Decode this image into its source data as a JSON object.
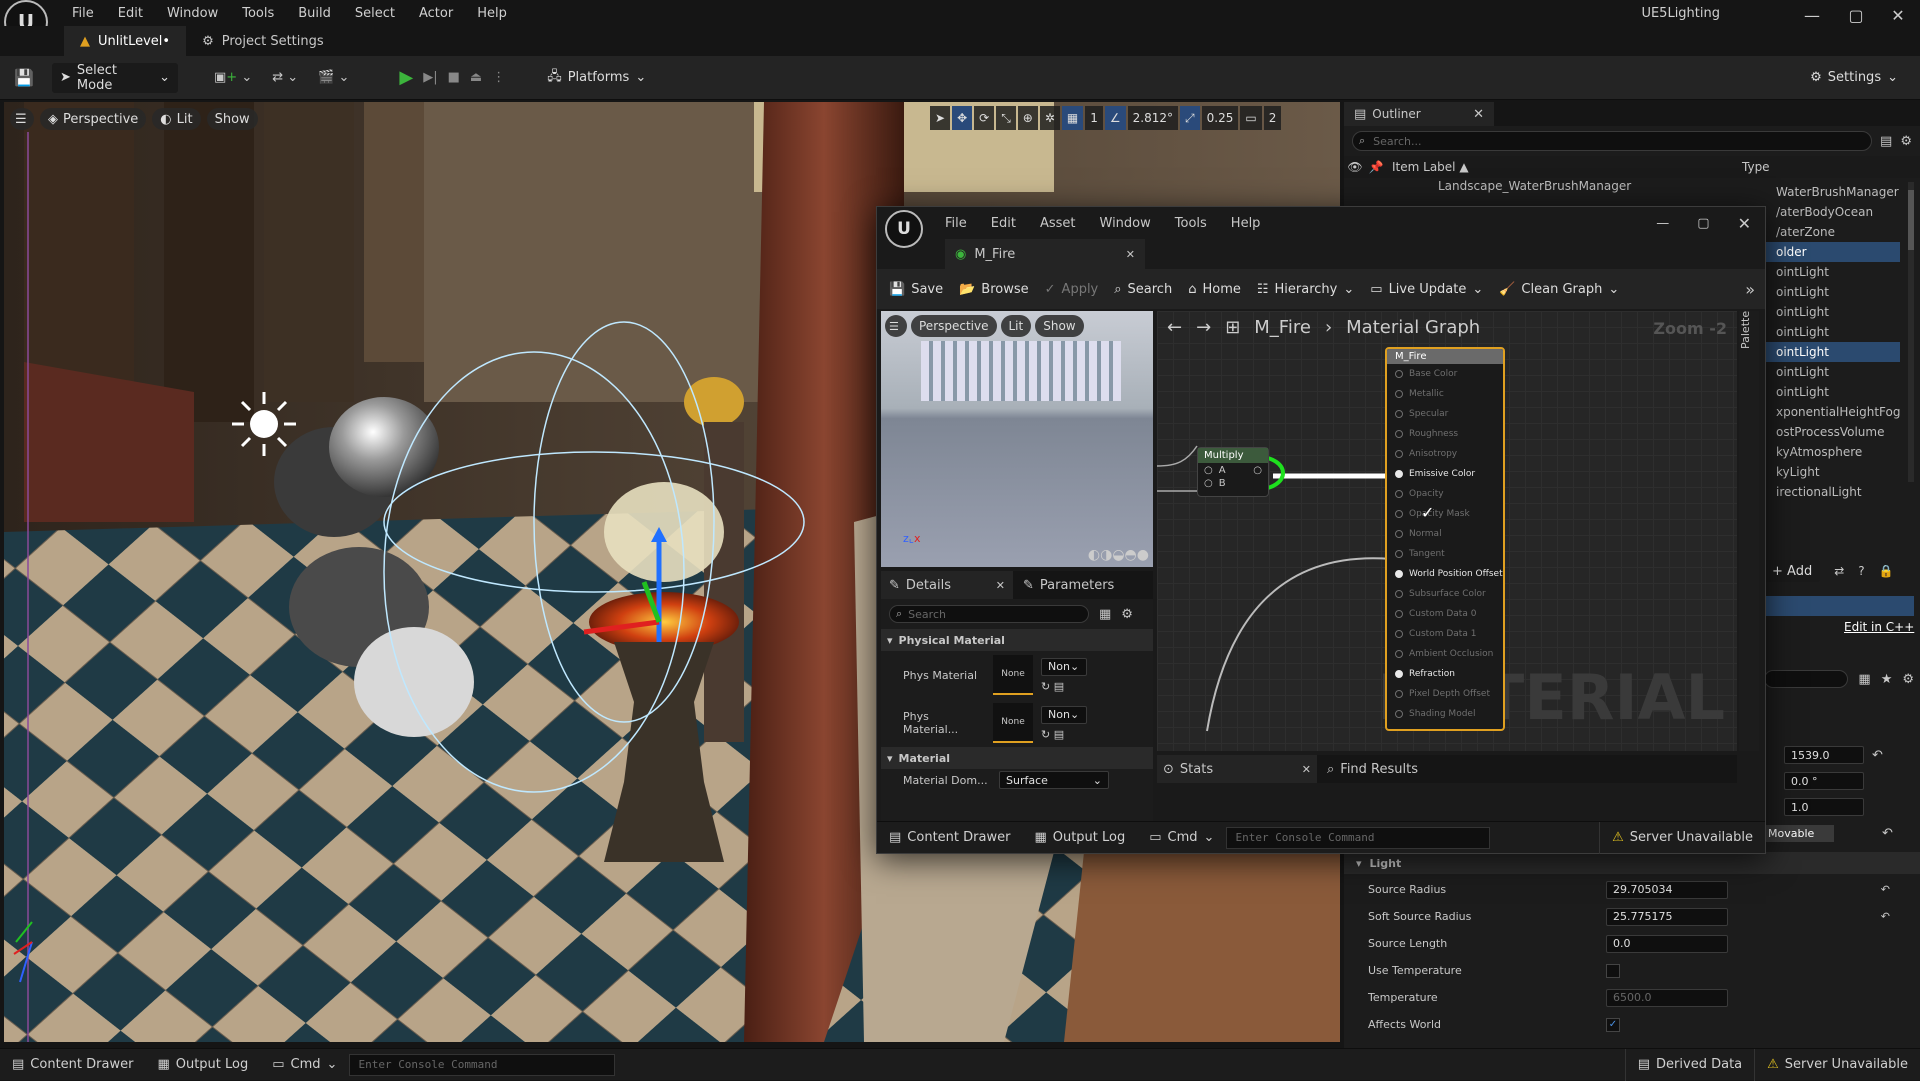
{
  "app": {
    "title": "UE5Lighting",
    "menu": [
      "File",
      "Edit",
      "Window",
      "Tools",
      "Build",
      "Select",
      "Actor",
      "Help"
    ]
  },
  "tabs": [
    {
      "label": "UnlitLevel•"
    },
    {
      "label": "Project Settings"
    }
  ],
  "toolbar": {
    "select_mode": "Select Mode",
    "platforms": "Platforms",
    "settings": "Settings"
  },
  "viewport": {
    "perspective": "Perspective",
    "lit": "Lit",
    "show": "Show",
    "grid": "1",
    "angle": "2.812°",
    "scale": "0.25",
    "camera": "2"
  },
  "outliner": {
    "title": "Outliner",
    "search_placeholder": "Search...",
    "col_label": "Item Label ▲",
    "col_type": "Type",
    "first_item": "Landscape_WaterBrushManager",
    "types": [
      "WaterBrushManager",
      "WaterBodyOcean",
      "WaterZone",
      "Folder",
      "PointLight",
      "PointLight",
      "PointLight",
      "PointLight",
      "PointLight",
      "PointLight",
      "PointLight",
      "ExponentialHeightFog",
      "PostProcessVolume",
      "SkyAtmosphere",
      "SkyLight",
      "DirectionalLight"
    ],
    "type_prefix_visible": [
      "WaterBrushManager",
      "/aterBodyOcean",
      "/aterZone",
      "older",
      "ointLight",
      "ointLight",
      "ointLight",
      "ointLight",
      "ointLight",
      "ointLight",
      "ointLight",
      "xponentialHeightFog",
      "ostProcessVolume",
      "kyAtmosphere",
      "kyLight",
      "irectionalLight"
    ],
    "selected_index": [
      3,
      8
    ]
  },
  "details": {
    "add": "+ Add",
    "edit_cpp": "Edit in C++",
    "loc": "1539.0",
    "rot": "0.0 °",
    "scale": "1.0",
    "mobility": "Movable",
    "section": "Light",
    "props": [
      {
        "label": "Source Radius",
        "value": "29.705034"
      },
      {
        "label": "Soft Source Radius",
        "value": "25.775175"
      },
      {
        "label": "Source Length",
        "value": "0.0"
      },
      {
        "label": "Use Temperature",
        "value": ""
      },
      {
        "label": "Temperature",
        "value": "6500.0"
      },
      {
        "label": "Affects World",
        "value": ""
      }
    ]
  },
  "material_editor": {
    "menu": [
      "File",
      "Edit",
      "Asset",
      "Window",
      "Tools",
      "Help"
    ],
    "tab": "M_Fire",
    "toolbar": [
      "Save",
      "Browse",
      "Apply",
      "Search",
      "Home",
      "Hierarchy",
      "Live Update",
      "Clean Graph"
    ],
    "preview": {
      "perspective": "Perspective",
      "lit": "Lit",
      "show": "Show"
    },
    "details_tab": "Details",
    "parameters_tab": "Parameters",
    "search_placeholder": "Search",
    "sections": {
      "physical": "Physical Material",
      "material": "Material"
    },
    "phys_rows": [
      {
        "label": "Phys Material",
        "value": "None",
        "drop": "Non"
      },
      {
        "label": "Phys Material...",
        "value": "None",
        "drop": "Non"
      }
    ],
    "material_domain": {
      "label": "Material Dom...",
      "value": "Surface"
    },
    "breadcrumb": {
      "asset": "M_Fire",
      "graph": "Material Graph"
    },
    "zoom": "Zoom -2",
    "palette": "Palette",
    "watermark": "MATERIAL",
    "multiply": {
      "title": "Multiply",
      "a": "A",
      "b": "B"
    },
    "result_node": {
      "title": "M_Fire",
      "pins": [
        {
          "label": "Base Color",
          "on": false
        },
        {
          "label": "Metallic",
          "on": false
        },
        {
          "label": "Specular",
          "on": false
        },
        {
          "label": "Roughness",
          "on": false
        },
        {
          "label": "Anisotropy",
          "on": false
        },
        {
          "label": "Emissive Color",
          "on": true
        },
        {
          "label": "Opacity",
          "on": false
        },
        {
          "label": "Opacity Mask",
          "on": false
        },
        {
          "label": "Normal",
          "on": false
        },
        {
          "label": "Tangent",
          "on": false
        },
        {
          "label": "World Position Offset",
          "on": true
        },
        {
          "label": "Subsurface Color",
          "on": false
        },
        {
          "label": "Custom Data 0",
          "on": false
        },
        {
          "label": "Custom Data 1",
          "on": false
        },
        {
          "label": "Ambient Occlusion",
          "on": false
        },
        {
          "label": "Refraction",
          "on": true
        },
        {
          "label": "Pixel Depth Offset",
          "on": false
        },
        {
          "label": "Shading Model",
          "on": false
        }
      ]
    },
    "stats": "Stats",
    "find_results": "Find Results",
    "bottom": {
      "content_drawer": "Content Drawer",
      "output_log": "Output Log",
      "cmd": "Cmd",
      "console_placeholder": "Enter Console Command",
      "server": "Server Unavailable"
    }
  },
  "statusbar": {
    "content_drawer": "Content Drawer",
    "output_log": "Output Log",
    "cmd": "Cmd",
    "console_placeholder": "Enter Console Command",
    "derived_data": "Derived Data",
    "server": "Server Unavailable"
  },
  "colors": {
    "accent": "#1ee01e",
    "node_border": "#e0a020",
    "selection": "#2b4a6f",
    "play": "#3cb43c"
  }
}
